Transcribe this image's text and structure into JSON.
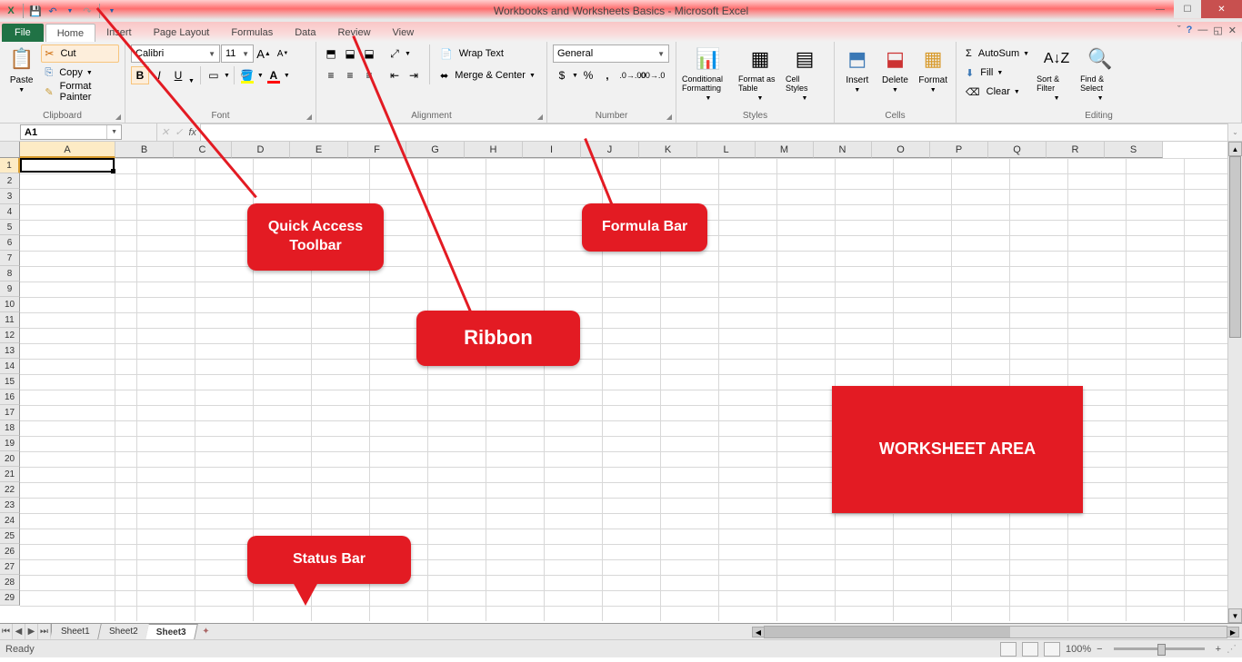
{
  "title": "Workbooks and Worksheets Basics - Microsoft Excel",
  "qat": {
    "save": "save-icon",
    "undo": "undo-icon",
    "redo": "redo-icon"
  },
  "tabs": {
    "file": "File",
    "home": "Home",
    "insert": "Insert",
    "pagelayout": "Page Layout",
    "formulas": "Formulas",
    "data": "Data",
    "review": "Review",
    "view": "View"
  },
  "ribbon": {
    "clipboard": {
      "label": "Clipboard",
      "paste": "Paste",
      "cut": "Cut",
      "copy": "Copy",
      "painter": "Format Painter"
    },
    "font": {
      "label": "Font",
      "name": "Calibri",
      "size": "11",
      "bold": "B",
      "italic": "I",
      "underline": "U"
    },
    "alignment": {
      "label": "Alignment",
      "wrap": "Wrap Text",
      "merge": "Merge & Center"
    },
    "number": {
      "label": "Number",
      "format": "General",
      "currency": "$",
      "percent": "%",
      "comma": ",",
      "incdec": ".0",
      "decinc": ".00"
    },
    "styles": {
      "label": "Styles",
      "cond": "Conditional Formatting",
      "table": "Format as Table",
      "cell": "Cell Styles"
    },
    "cells": {
      "label": "Cells",
      "insert": "Insert",
      "delete": "Delete",
      "format": "Format"
    },
    "editing": {
      "label": "Editing",
      "autosum": "AutoSum",
      "fill": "Fill",
      "clear": "Clear",
      "sort": "Sort & Filter",
      "find": "Find & Select"
    }
  },
  "namebox": "A1",
  "columns": [
    "A",
    "B",
    "C",
    "D",
    "E",
    "F",
    "G",
    "H",
    "I",
    "J",
    "K",
    "L",
    "M",
    "N",
    "O",
    "P",
    "Q",
    "R",
    "S"
  ],
  "rows": [
    "1",
    "2",
    "3",
    "4",
    "5",
    "6",
    "7",
    "8",
    "9",
    "10",
    "11",
    "12",
    "13",
    "14",
    "15",
    "16",
    "17",
    "18",
    "19",
    "20",
    "21",
    "22",
    "23",
    "24",
    "25",
    "26",
    "27",
    "28",
    "29"
  ],
  "callouts": {
    "qat": "Quick Access Toolbar",
    "ribbon": "Ribbon",
    "formula": "Formula Bar",
    "worksheet": "WORKSHEET AREA",
    "status": "Status Bar"
  },
  "sheets": {
    "s1": "Sheet1",
    "s2": "Sheet2",
    "s3": "Sheet3"
  },
  "status": {
    "ready": "Ready",
    "zoom": "100%"
  }
}
